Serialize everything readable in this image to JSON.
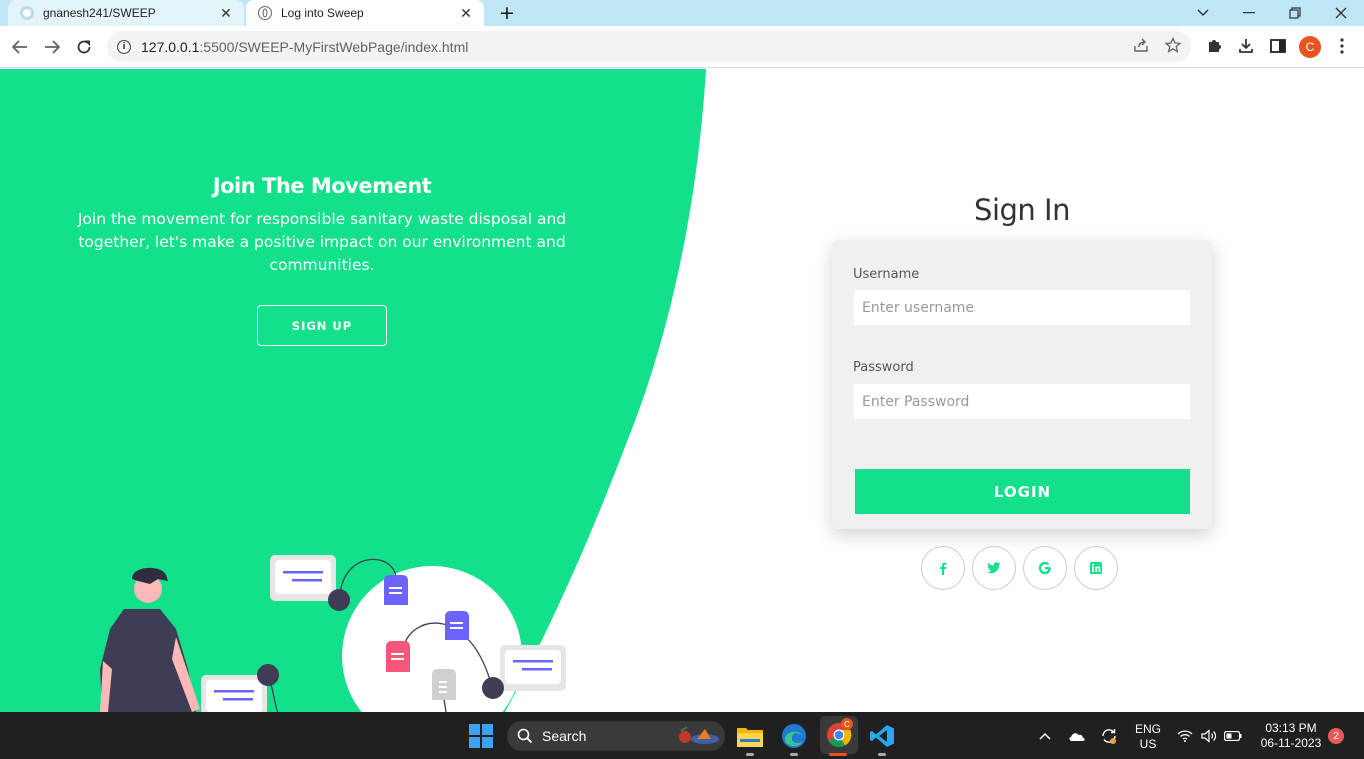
{
  "browser": {
    "tabs": [
      {
        "title": "gnanesh241/SWEEP",
        "active": false
      },
      {
        "title": "Log into Sweep",
        "active": true
      }
    ],
    "url_host": "127.0.0.1",
    "url_rest": ":5500/SWEEP-MyFirstWebPage/index.html",
    "profile_initial": "C"
  },
  "hero": {
    "title": "Join The Movement",
    "text": "Join the movement for responsible sanitary waste disposal and together, let's make a positive impact on our environment and communities.",
    "signup_label": "SIGN UP"
  },
  "signin": {
    "title": "Sign In",
    "username_label": "Username",
    "username_placeholder": "Enter username",
    "password_label": "Password",
    "password_placeholder": "Enter Password",
    "login_label": "LOGIN",
    "social": [
      {
        "name": "facebook",
        "glyph": "f"
      },
      {
        "name": "twitter",
        "glyph": "t"
      },
      {
        "name": "google",
        "glyph": "G"
      },
      {
        "name": "linkedin",
        "glyph": "in"
      }
    ]
  },
  "taskbar": {
    "search_label": "Search",
    "lang_top": "ENG",
    "lang_bottom": "US",
    "time": "03:13 PM",
    "date": "06-11-2023",
    "notification_count": "2"
  },
  "colors": {
    "accent": "#12e08a",
    "purple": "#6c63ff",
    "pink": "#f5567a",
    "dark": "#3f3d56"
  }
}
